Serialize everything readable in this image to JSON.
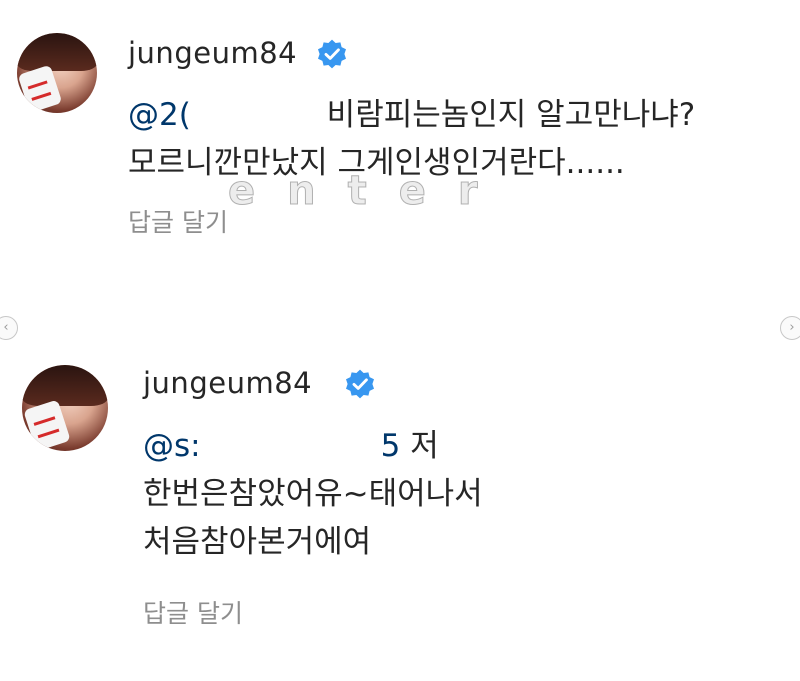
{
  "comments": [
    {
      "username": "jungeum84",
      "mention": "@2(",
      "mention_tail": "",
      "text_line1": " 비람피는놈인지 알고만나냐?",
      "text_line2": "모르니깐만났지 그게인생인거란다......",
      "text_line3": "",
      "reply_label": "답글 달기"
    },
    {
      "username": "jungeum84",
      "mention": "@s:",
      "mention_tail": "5",
      "text_line1": " 저",
      "text_line2": "한번은참았어유~태어나서",
      "text_line3": "처음참아본거에여",
      "reply_label": "답글 달기"
    }
  ],
  "watermark": "enter",
  "icons": {
    "verified": "verified-badge-icon",
    "prev": "chevron-left-icon",
    "next": "chevron-right-icon"
  },
  "colors": {
    "verified_blue": "#3897f0",
    "mention": "#00376b",
    "secondary_text": "#8e8e8e"
  }
}
